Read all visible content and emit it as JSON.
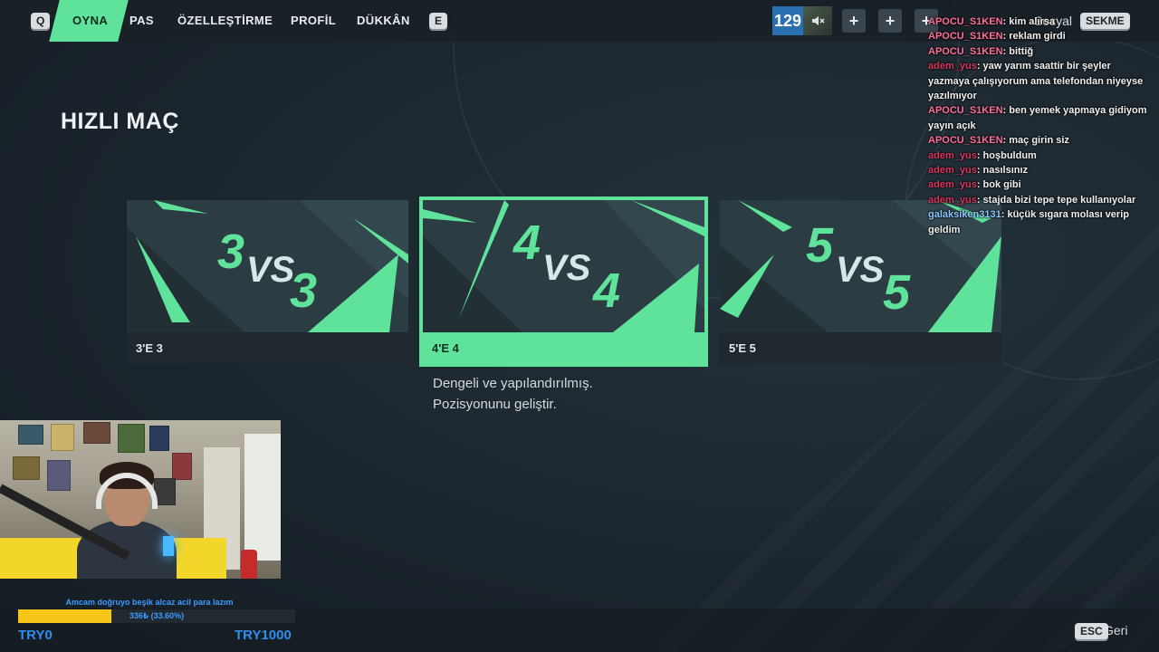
{
  "topbar": {
    "key_left": "Q",
    "key_right": "E",
    "nav": [
      {
        "label": "OYNA",
        "active": true
      },
      {
        "label": "PAS",
        "active": false
      },
      {
        "label": "ÖZELLEŞTİRME",
        "active": false
      },
      {
        "label": "PROFİL",
        "active": false
      },
      {
        "label": "DÜKKÂN",
        "active": false
      }
    ],
    "level": "129",
    "muted_icon": "speaker-muted-icon",
    "plus": "+",
    "social_label": "Sosyal",
    "social_key": "SEKME"
  },
  "page": {
    "title": "HIZLI MAÇ"
  },
  "modes": [
    {
      "art": [
        "3",
        "VS",
        "3"
      ],
      "label": "3'E 3",
      "selected": false
    },
    {
      "art": [
        "4",
        "VS",
        "4"
      ],
      "label": "4'E 4",
      "selected": true
    },
    {
      "art": [
        "5",
        "VS",
        "5"
      ],
      "label": "5'E 5",
      "selected": false
    }
  ],
  "selected_description": {
    "line1": "Dengeli ve yapılandırılmış.",
    "line2": "Pozisyonunu geliştir."
  },
  "chat": [
    {
      "user": "APOCU_S1KEN",
      "text": "kim alırsa",
      "cls": "u1"
    },
    {
      "user": "APOCU_S1KEN",
      "text": "reklam girdi",
      "cls": "u1"
    },
    {
      "user": "APOCU_S1KEN",
      "text": "bittiğ",
      "cls": "u1"
    },
    {
      "user": "adem_yus",
      "text": "yaw yarım saattir bir şeyler yazmaya çalışıyorum ama telefondan niyeyse yazılmıyor",
      "cls": "u2"
    },
    {
      "user": "APOCU_S1KEN",
      "text": "ben yemek yapmaya gidiyom yayın açık",
      "cls": "u1"
    },
    {
      "user": "APOCU_S1KEN",
      "text": "maç girin siz",
      "cls": "u1"
    },
    {
      "user": "adem_yus",
      "text": "hoşbuldum",
      "cls": "u2"
    },
    {
      "user": "adem_yus",
      "text": "nasılsınız",
      "cls": "u2"
    },
    {
      "user": "adem_yus",
      "text": "bok gibi",
      "cls": "u2"
    },
    {
      "user": "adem_yus",
      "text": "stajda bizi tepe tepe kullanıyolar",
      "cls": "u2"
    },
    {
      "user": "galaksiken3131",
      "text": "küçük sıgara molası verip geldim",
      "cls": "u3"
    }
  ],
  "donation": {
    "message": "Amcam doğruyo beşik alcaz acil para lazım",
    "amount": "336₺ (33.60%)",
    "progress": 0.336,
    "min_label": "TRY0",
    "max_label": "TRY1000",
    "fill_color": "#f5c518"
  },
  "bottombar": {
    "back_key": "ESC",
    "back_label": "Geri"
  },
  "colors": {
    "accent": "#5fe39a",
    "level_badge": "#2a6fb0"
  }
}
